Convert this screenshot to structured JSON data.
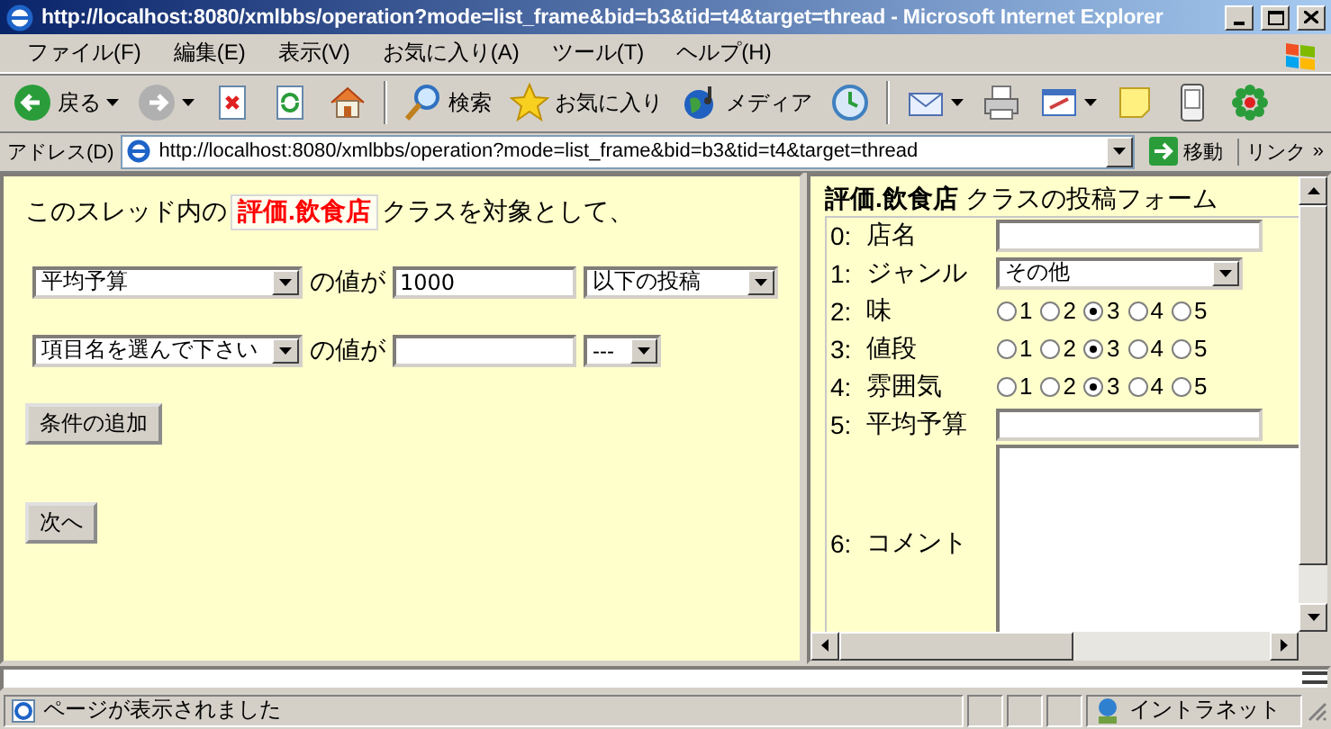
{
  "window": {
    "title": "http://localhost:8080/xmlbbs/operation?mode=list_frame&bid=b3&tid=t4&target=thread - Microsoft Internet Explorer"
  },
  "menu": [
    "ファイル(F)",
    "編集(E)",
    "表示(V)",
    "お気に入り(A)",
    "ツール(T)",
    "ヘルプ(H)"
  ],
  "toolbar": [
    {
      "kind": "back",
      "label": "戻る",
      "dropdown": true
    },
    {
      "kind": "forward",
      "dropdown": true
    },
    {
      "kind": "stop",
      "dropdown": false
    },
    {
      "kind": "refresh",
      "dropdown": false
    },
    {
      "kind": "home",
      "dropdown": false
    },
    {
      "kind": "separator"
    },
    {
      "kind": "search",
      "label": "検索",
      "dropdown": false
    },
    {
      "kind": "favorites",
      "label": "お気に入り",
      "dropdown": false
    },
    {
      "kind": "media",
      "label": "メディア",
      "dropdown": false
    },
    {
      "kind": "history",
      "dropdown": false
    },
    {
      "kind": "separator"
    },
    {
      "kind": "mail",
      "dropdown": true
    },
    {
      "kind": "print",
      "dropdown": false
    },
    {
      "kind": "edit",
      "dropdown": true
    },
    {
      "kind": "note",
      "dropdown": false
    },
    {
      "kind": "device",
      "dropdown": false
    },
    {
      "kind": "flower",
      "dropdown": false
    }
  ],
  "address": {
    "label": "アドレス(D)",
    "url": "http://localhost:8080/xmlbbs/operation?mode=list_frame&bid=b3&tid=t4&target=thread",
    "go": "移動",
    "links": "リンク",
    "more": "»"
  },
  "left_frame": {
    "intro_before": "このスレッド内の",
    "class_name": "評価.飲食店",
    "intro_after": "クラスを対象として、",
    "conditions": [
      {
        "field": "平均予算",
        "connector": "の値が",
        "value": "1000",
        "operator": "以下の投稿"
      },
      {
        "field": "項目名を選んで下さい",
        "connector": "の値が",
        "operator": "---"
      }
    ],
    "add_button": "条件の追加",
    "next_button": "次へ"
  },
  "right_frame": {
    "title_bold": "評価.飲食店",
    "title_rest": "クラスの投稿フォーム",
    "fields": [
      {
        "index": "0:",
        "label": "店名",
        "kind": "text"
      },
      {
        "index": "1:",
        "label": "ジャンル",
        "kind": "select",
        "value": "その他"
      },
      {
        "index": "2:",
        "label": "味",
        "kind": "rating",
        "options": [
          {
            "label": "1",
            "selected": false
          },
          {
            "label": "2",
            "selected": false
          },
          {
            "label": "3",
            "selected": true
          },
          {
            "label": "4",
            "selected": false
          },
          {
            "label": "5",
            "selected": false
          }
        ]
      },
      {
        "index": "3:",
        "label": "値段",
        "kind": "rating",
        "options": [
          {
            "label": "1",
            "selected": false
          },
          {
            "label": "2",
            "selected": false
          },
          {
            "label": "3",
            "selected": true
          },
          {
            "label": "4",
            "selected": false
          },
          {
            "label": "5",
            "selected": false
          }
        ]
      },
      {
        "index": "4:",
        "label": "雰囲気",
        "kind": "rating",
        "options": [
          {
            "label": "1",
            "selected": false
          },
          {
            "label": "2",
            "selected": false
          },
          {
            "label": "3",
            "selected": true
          },
          {
            "label": "4",
            "selected": false
          },
          {
            "label": "5",
            "selected": false
          }
        ]
      },
      {
        "index": "5:",
        "label": "平均予算",
        "kind": "text"
      },
      {
        "index": "6:",
        "label": "コメント",
        "kind": "textarea"
      }
    ]
  },
  "status_bar": {
    "text": "ページが表示されました",
    "zone": "イントラネット"
  }
}
